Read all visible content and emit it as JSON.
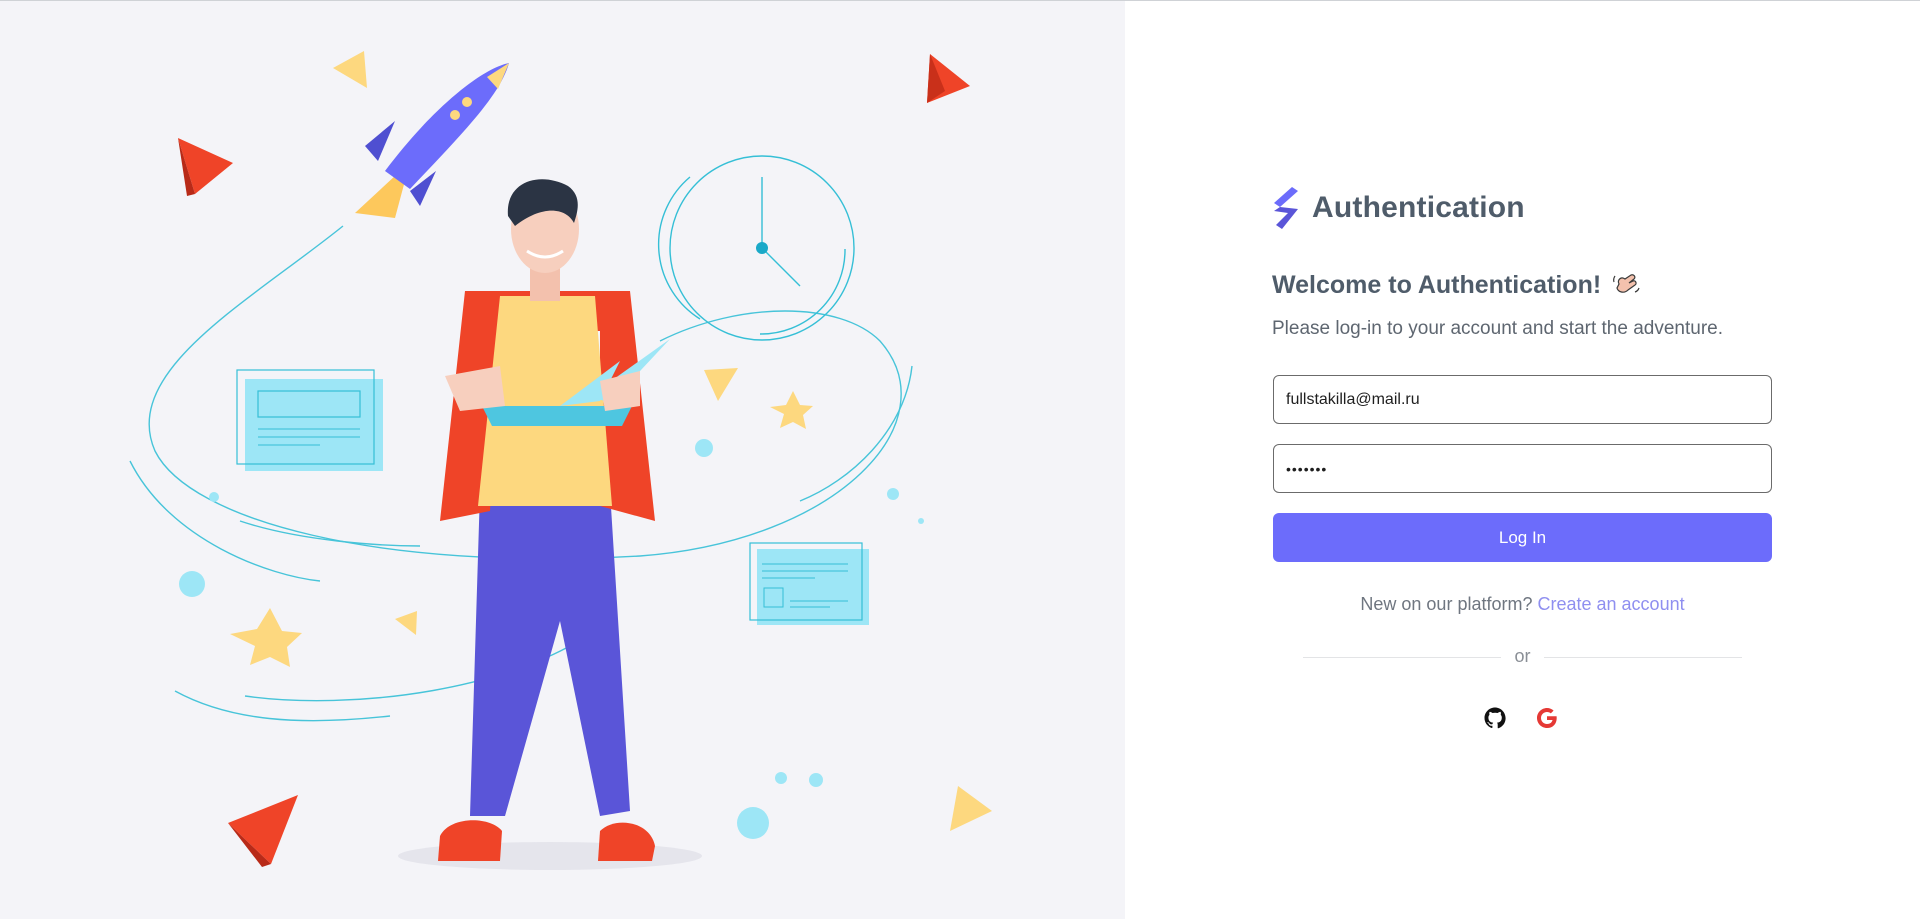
{
  "brand": {
    "name": "Authentication",
    "logo_icon": "s-shaped-brand-logo",
    "accent_color": "#6c6cfb"
  },
  "welcome": {
    "title": "Welcome to Authentication!",
    "emoji_icon": "waving-hand-icon",
    "subtitle": "Please log-in to your account and start the adventure."
  },
  "form": {
    "email_value": "fullstakilla@mail.ru",
    "password_value": "•••••••",
    "login_label": "Log In",
    "login_color": "#6c6cfb"
  },
  "signup": {
    "prompt": "New on our platform?",
    "link_label": "Create an account"
  },
  "divider": {
    "label": "or"
  },
  "social": {
    "items": [
      {
        "icon": "github-icon"
      },
      {
        "icon": "google-icon",
        "color": "#e53935"
      }
    ]
  },
  "illustration": {
    "description_icon": "man-with-tablet-illustration"
  }
}
